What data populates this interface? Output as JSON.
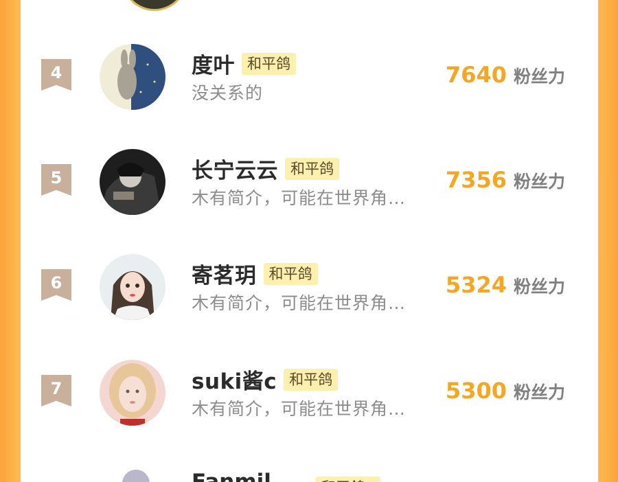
{
  "colors": {
    "accent": "#f5a623",
    "tag_bg": "#fdf0ae",
    "rank_badge": "#c9b09c",
    "frame": "#ffb84f"
  },
  "users": [
    {
      "rank": "4",
      "name": "度叶",
      "tag": "和平鸽",
      "desc": "没关系的",
      "score": "7640",
      "unit": "粉丝力"
    },
    {
      "rank": "5",
      "name": "长宁云云",
      "tag": "和平鸽",
      "desc": "木有简介，可能在世界角…",
      "score": "7356",
      "unit": "粉丝力"
    },
    {
      "rank": "6",
      "name": "寄茗玥",
      "tag": "和平鸽",
      "desc": "木有简介，可能在世界角…",
      "score": "5324",
      "unit": "粉丝力"
    },
    {
      "rank": "7",
      "name": "suki酱c",
      "tag": "和平鸽",
      "desc": "木有简介，可能在世界角…",
      "score": "5300",
      "unit": "粉丝力"
    }
  ],
  "partial": {
    "name": "Fanmil",
    "tag": "和平鸽"
  }
}
